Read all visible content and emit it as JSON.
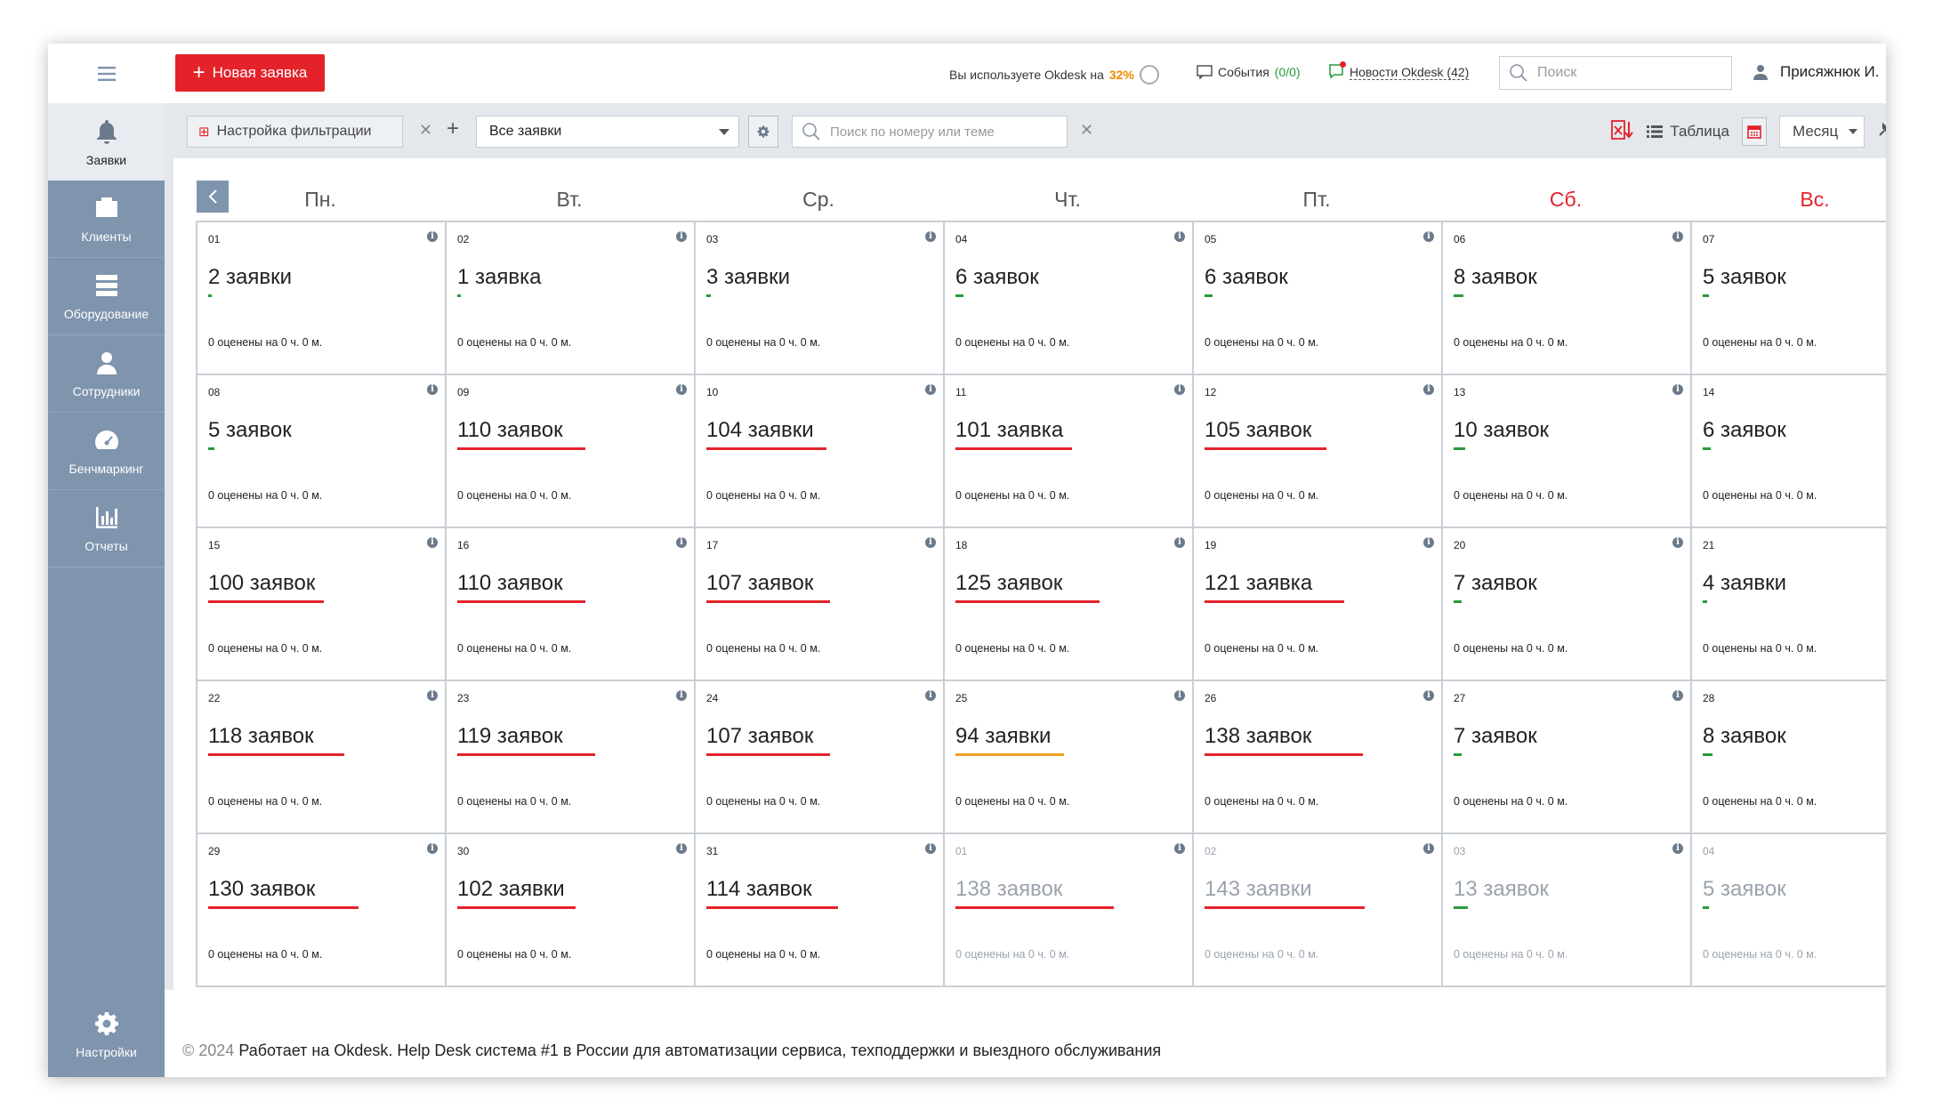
{
  "sidebar": {
    "items": [
      {
        "label": "Заявки",
        "icon": "bell-icon",
        "active": true
      },
      {
        "label": "Клиенты",
        "icon": "briefcase-icon"
      },
      {
        "label": "Оборудование",
        "icon": "server-icon"
      },
      {
        "label": "Сотрудники",
        "icon": "user-icon"
      },
      {
        "label": "Бенчмаркинг",
        "icon": "speedometer-icon"
      },
      {
        "label": "Отчеты",
        "icon": "bar-chart-icon"
      }
    ],
    "settings_label": "Настройки"
  },
  "topbar": {
    "new_button": "Новая заявка",
    "usage_prefix": "Вы используете Okdesk на",
    "usage_value": "32%",
    "events_label": "События",
    "events_count": "(0/0)",
    "news_label": "Новости Okdesk (42)",
    "search_placeholder": "Поиск",
    "user_name": "Присяжнюк И."
  },
  "filterbar": {
    "setup_label": "Настройка фильтрации",
    "view_select": "Все заявки",
    "search_placeholder": "Поиск по номеру или теме",
    "table_label": "Таблица",
    "period_select": "Месяц"
  },
  "calendar": {
    "weekdays": [
      "Пн.",
      "Вт.",
      "Ср.",
      "Чт.",
      "Пт.",
      "Сб.",
      "Вс."
    ],
    "rated_text": "0 оценены на 0 ч. 0 м.",
    "colors": {
      "green": "#2a9a3a",
      "red": "#e4222a",
      "orange": "#f0a020"
    },
    "days": [
      {
        "day": "01",
        "count": "2 заявки",
        "load": 0.02,
        "color": "green"
      },
      {
        "day": "02",
        "count": "1 заявка",
        "load": 0.01,
        "color": "green"
      },
      {
        "day": "03",
        "count": "3 заявки",
        "load": 0.03,
        "color": "green"
      },
      {
        "day": "04",
        "count": "6 заявок",
        "load": 0.05,
        "color": "green"
      },
      {
        "day": "05",
        "count": "6 заявок",
        "load": 0.05,
        "color": "green"
      },
      {
        "day": "06",
        "count": "8 заявок",
        "load": 0.06,
        "color": "green"
      },
      {
        "day": "07",
        "count": "5 заявок",
        "load": 0.04,
        "color": "green"
      },
      {
        "day": "08",
        "count": "5 заявок",
        "load": 0.04,
        "color": "green"
      },
      {
        "day": "09",
        "count": "110 заявок",
        "load": 0.8,
        "color": "red"
      },
      {
        "day": "10",
        "count": "104 заявки",
        "load": 0.75,
        "color": "red"
      },
      {
        "day": "11",
        "count": "101 заявка",
        "load": 0.73,
        "color": "red"
      },
      {
        "day": "12",
        "count": "105 заявок",
        "load": 0.76,
        "color": "red"
      },
      {
        "day": "13",
        "count": "10 заявок",
        "load": 0.07,
        "color": "green"
      },
      {
        "day": "14",
        "count": "6 заявок",
        "load": 0.05,
        "color": "green"
      },
      {
        "day": "15",
        "count": "100 заявок",
        "load": 0.72,
        "color": "red"
      },
      {
        "day": "16",
        "count": "110 заявок",
        "load": 0.8,
        "color": "red"
      },
      {
        "day": "17",
        "count": "107 заявок",
        "load": 0.77,
        "color": "red"
      },
      {
        "day": "18",
        "count": "125 заявок",
        "load": 0.9,
        "color": "red"
      },
      {
        "day": "19",
        "count": "121 заявка",
        "load": 0.87,
        "color": "red"
      },
      {
        "day": "20",
        "count": "7 заявок",
        "load": 0.05,
        "color": "green"
      },
      {
        "day": "21",
        "count": "4 заявки",
        "load": 0.03,
        "color": "green"
      },
      {
        "day": "22",
        "count": "118 заявок",
        "load": 0.85,
        "color": "red"
      },
      {
        "day": "23",
        "count": "119 заявок",
        "load": 0.86,
        "color": "red"
      },
      {
        "day": "24",
        "count": "107 заявок",
        "load": 0.77,
        "color": "red"
      },
      {
        "day": "25",
        "count": "94 заявки",
        "load": 0.68,
        "color": "orange"
      },
      {
        "day": "26",
        "count": "138 заявок",
        "load": 0.99,
        "color": "red"
      },
      {
        "day": "27",
        "count": "7 заявок",
        "load": 0.05,
        "color": "green"
      },
      {
        "day": "28",
        "count": "8 заявок",
        "load": 0.06,
        "color": "green"
      },
      {
        "day": "29",
        "count": "130 заявок",
        "load": 0.94,
        "color": "red"
      },
      {
        "day": "30",
        "count": "102 заявки",
        "load": 0.74,
        "color": "red"
      },
      {
        "day": "31",
        "count": "114 заявок",
        "load": 0.82,
        "color": "red"
      },
      {
        "day": "01",
        "count": "138 заявок",
        "load": 0.99,
        "color": "red",
        "other_month": true
      },
      {
        "day": "02",
        "count": "143 заявки",
        "load": 1.0,
        "color": "red",
        "other_month": true
      },
      {
        "day": "03",
        "count": "13 заявок",
        "load": 0.09,
        "color": "green",
        "other_month": true
      },
      {
        "day": "04",
        "count": "5 заявок",
        "load": 0.04,
        "color": "green",
        "other_month": true
      }
    ]
  },
  "footer": {
    "copyright": "© 2024",
    "text": "Работает на Okdesk. Help Desk система #1 в России для автоматизации сервиса, техподдержки и выездного обслуживания"
  }
}
